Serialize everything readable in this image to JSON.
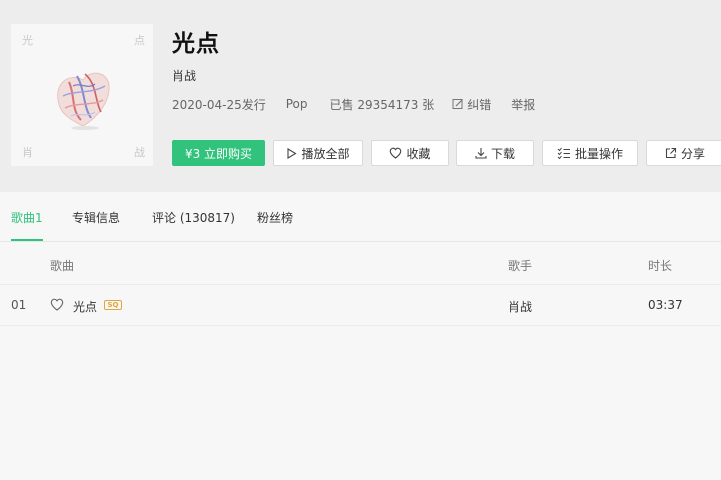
{
  "album": {
    "cover_chars": {
      "tl": "光",
      "tr": "点",
      "bl": "肖",
      "br": "战"
    },
    "title": "光点",
    "artist": "肖战",
    "release": "2020-04-25发行",
    "genre": "Pop",
    "sold": "已售 29354173 张",
    "correct_label": "纠错",
    "report_label": "举报"
  },
  "actions": {
    "buy": "¥3 立即购买",
    "play_all": "播放全部",
    "favorite": "收藏",
    "download": "下载",
    "batch": "批量操作",
    "share": "分享"
  },
  "tabs": [
    {
      "label": "歌曲1"
    },
    {
      "label": "专辑信息"
    },
    {
      "label": "评论 (130817)"
    },
    {
      "label": "粉丝榜"
    }
  ],
  "table": {
    "headers": {
      "song": "歌曲",
      "singer": "歌手",
      "duration": "时长"
    },
    "rows": [
      {
        "index": "01",
        "title": "光点",
        "badge": "SQ",
        "singer": "肖战",
        "duration": "03:37"
      }
    ]
  },
  "colors": {
    "accent": "#31c27c",
    "badge": "#e2a53c"
  },
  "icons": [
    "play-icon",
    "heart-icon",
    "download-icon",
    "batch-list-icon",
    "share-icon",
    "edit-icon"
  ]
}
